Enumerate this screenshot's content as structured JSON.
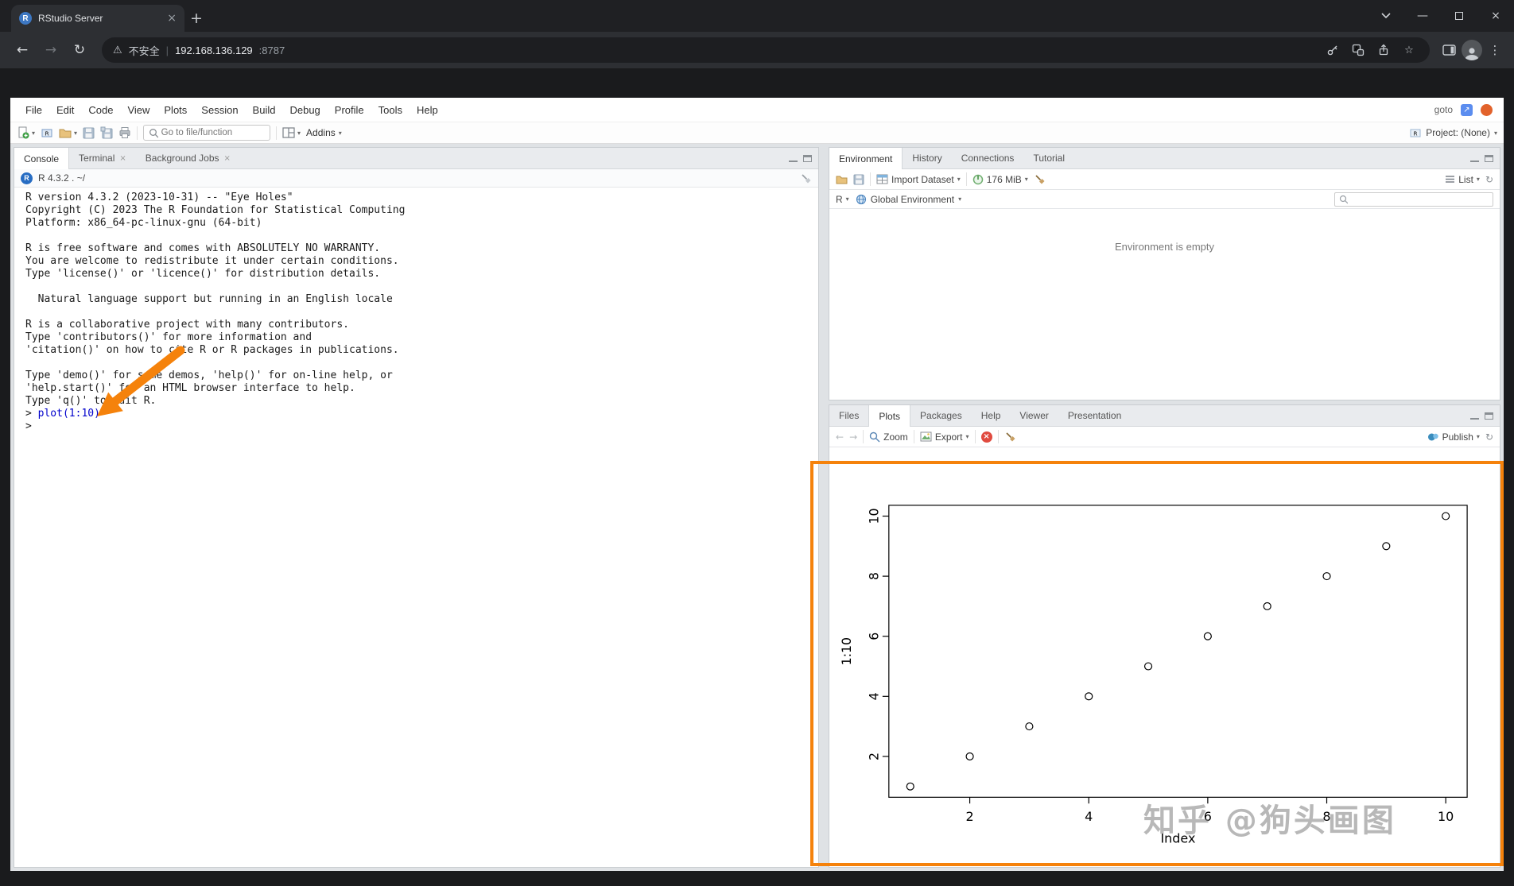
{
  "browser": {
    "tab_title": "RStudio Server",
    "security_label": "不安全",
    "url_host": "192.168.136.129",
    "url_port": ":8787"
  },
  "rstudio": {
    "menu": {
      "items": [
        "File",
        "Edit",
        "Code",
        "View",
        "Plots",
        "Session",
        "Build",
        "Debug",
        "Profile",
        "Tools",
        "Help"
      ],
      "goto_label": "goto"
    },
    "toolbar": {
      "search_placeholder": "Go to file/function",
      "addins_label": "Addins",
      "project_label": "Project: (None)"
    },
    "console": {
      "tabs": [
        "Console",
        "Terminal",
        "Background Jobs"
      ],
      "version_line": "R 4.3.2 . ~/",
      "output": "R version 4.3.2 (2023-10-31) -- \"Eye Holes\"\nCopyright (C) 2023 The R Foundation for Statistical Computing\nPlatform: x86_64-pc-linux-gnu (64-bit)\n\nR is free software and comes with ABSOLUTELY NO WARRANTY.\nYou are welcome to redistribute it under certain conditions.\nType 'license()' or 'licence()' for distribution details.\n\n  Natural language support but running in an English locale\n\nR is a collaborative project with many contributors.\nType 'contributors()' for more information and\n'citation()' on how to cite R or R packages in publications.\n\nType 'demo()' for some demos, 'help()' for on-line help, or\n'help.start()' for an HTML browser interface to help.\nType 'q()' to quit R.\n",
      "prompt": ">",
      "command": "plot(1:10)"
    },
    "environment": {
      "tabs": [
        "Environment",
        "History",
        "Connections",
        "Tutorial"
      ],
      "import_label": "Import Dataset",
      "memory_label": "176 MiB",
      "list_label": "List",
      "language_label": "R",
      "scope_label": "Global Environment",
      "empty_message": "Environment is empty"
    },
    "files_pane": {
      "tabs": [
        "Files",
        "Plots",
        "Packages",
        "Help",
        "Viewer",
        "Presentation"
      ],
      "zoom_label": "Zoom",
      "export_label": "Export",
      "publish_label": "Publish"
    }
  },
  "chart_data": {
    "type": "scatter",
    "x": [
      1,
      2,
      3,
      4,
      5,
      6,
      7,
      8,
      9,
      10
    ],
    "y": [
      1,
      2,
      3,
      4,
      5,
      6,
      7,
      8,
      9,
      10
    ],
    "xlabel": "Index",
    "ylabel": "1:10",
    "xlim": [
      1,
      10
    ],
    "ylim": [
      1,
      10
    ],
    "xticks": [
      2,
      4,
      6,
      8,
      10
    ],
    "yticks": [
      2,
      4,
      6,
      8,
      10
    ],
    "marker": "open-circle",
    "grid": false
  },
  "annotations": {
    "watermark": "知乎 @狗头画图",
    "highlight_color": "#f5820b"
  }
}
